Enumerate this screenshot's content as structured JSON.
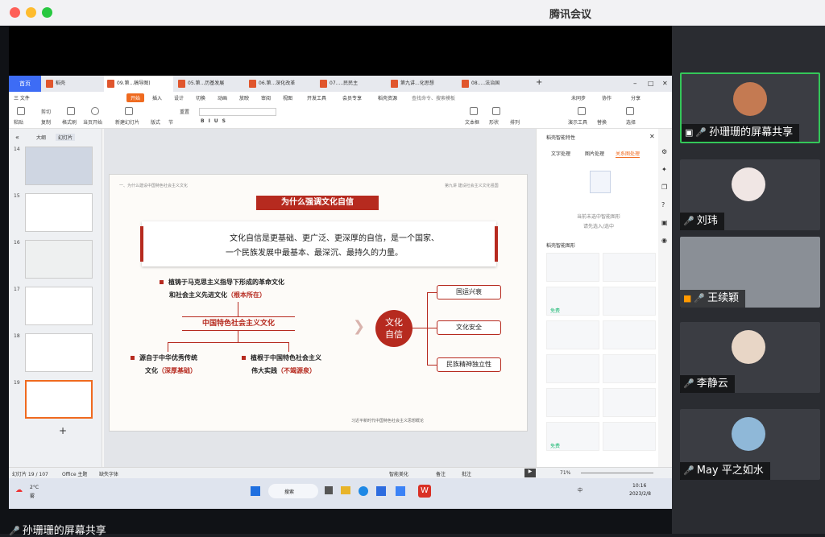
{
  "app": {
    "title": "腾讯会议"
  },
  "wps": {
    "home": "首页",
    "tab_wps": "稻壳",
    "tabs": [
      "09.第...稿导图)",
      "05.第...历基发展",
      "06.第...深化改革",
      "07.....民民主",
      "第九讲...化思想",
      "08.....法治国"
    ],
    "menus": [
      "三 文件",
      "开始",
      "插入",
      "设计",
      "切换",
      "动画",
      "放映",
      "审阅",
      "视图",
      "开发工具",
      "会员专享",
      "稻壳资源",
      "查找命令、搜索模板",
      "未同步",
      "协作",
      "分享"
    ],
    "ribbon": [
      "粘贴",
      "剪切",
      "复制",
      "格式刷",
      "当页开始",
      "新建幻灯片",
      "版式",
      "节",
      "重置",
      "文本框",
      "形状",
      "排列",
      "演示工具",
      "替换",
      "选择"
    ]
  },
  "left": {
    "outline": "大纲",
    "slides_tab": "幻灯片",
    "numbers": [
      "14",
      "15",
      "16",
      "17",
      "18",
      "19"
    ]
  },
  "slide": {
    "header_left": "一、为什么建设中国特色社会主义文化",
    "header_right": "第九讲  建设社会主义文化强国",
    "title": "为什么强调文化自信",
    "quote_line1": "文化自信是更基础、更广泛、更深厚的自信，是一个国家、",
    "quote_line2": "一个民族发展中最基本、最深沉、最持久的力量。",
    "b1_line1": "植铸于马克思主义指导下形成的革命文化",
    "b1_line2": "和社会主义先进文化",
    "b1_tag": "（根本所在）",
    "center": "中国特色社会主义文化",
    "b2_line1": "源自于中华优秀传统",
    "b2_line2": "文化",
    "b2_tag": "（深厚基础）",
    "b3_line1": "植根于中国特色社会主义",
    "b3_line2": "伟大实践",
    "b3_tag": "（不竭源泉）",
    "circle_l1": "文化",
    "circle_l2": "自信",
    "r1": "国运兴衰",
    "r2": "文化安全",
    "r3": "民族精神独立性",
    "footer": "习近平新时代中国特色社会主义思想概论"
  },
  "right": {
    "panel_title": "稻壳智能特性",
    "tab1": "文字处理",
    "tab2": "图片处理",
    "tab3": "关系图处理",
    "empty1": "当前未选中智能图形",
    "empty2": "请先选入/选中",
    "section": "稻壳智能图形",
    "badge1": "免费",
    "badge2": "免费"
  },
  "status": {
    "slide_info": "幻灯片 19 / 107",
    "theme": "Office 主题",
    "font": "缺失字体",
    "smart": "智能美化",
    "notes": "备注",
    "comment": "批注",
    "zoom": "71%"
  },
  "taskbar": {
    "temp": "2°C",
    "weather": "雾",
    "search": "搜索",
    "ime": "中",
    "time": "10:16",
    "date": "2023/2/8"
  },
  "meeting": {
    "sharer_label": "孙珊珊的屏幕共享"
  },
  "participants": [
    {
      "name": "孙珊珊的屏幕共享"
    },
    {
      "name": "刘玮"
    },
    {
      "name": "王续颖"
    },
    {
      "name": "李静云"
    },
    {
      "name": "May 平之如水"
    }
  ],
  "colors": {
    "accent_red": "#b62a1f",
    "wps_orange": "#ef6a1f",
    "active_green": "#34c759"
  }
}
